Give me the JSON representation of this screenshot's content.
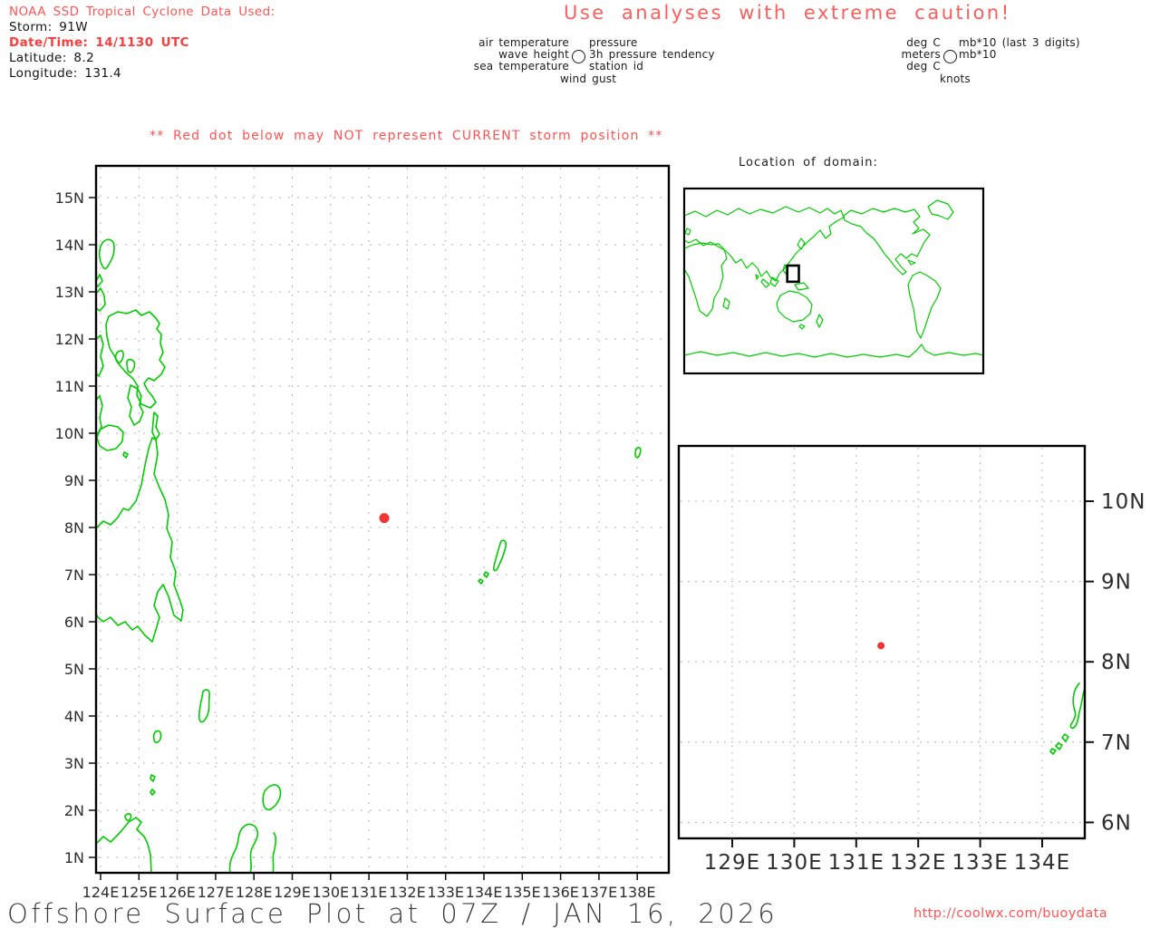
{
  "header": {
    "info_lines": [
      "NOAA SSD Tropical Cyclone Data Used:",
      "Storm: 91W",
      "Date/Time: 14/1130 UTC",
      "Latitude: 8.2",
      "Longitude: 131.4"
    ],
    "caution": "Use analyses with extreme caution!"
  },
  "station_legend": {
    "rows": [
      {
        "left": "air temperature",
        "right": "pressure"
      },
      {
        "left": "wave height",
        "right": "3h pressure tendency"
      },
      {
        "left": "sea temperature",
        "right": "station id"
      }
    ],
    "bottom": "wind gust",
    "units_rows": [
      {
        "left": "deg C",
        "right": "mb*10 (last 3 digits)"
      },
      {
        "left": "meters",
        "right": "mb*10"
      },
      {
        "left": "deg C",
        "right": ""
      }
    ],
    "units_bottom": "knots"
  },
  "warning": "** Red dot below may NOT represent CURRENT storm position **",
  "domain_inset": {
    "title": "Location of domain:"
  },
  "footer": {
    "title": "Offshore Surface Plot at 07Z / JAN 16, 2026",
    "url": "http://coolwx.com/buoydata"
  },
  "colors": {
    "red_text": "#ff5454",
    "red_bold": "#ff3b3b",
    "coastline": "#00cc00",
    "storm_dot": "#f03535",
    "grid": "#b4b4b4",
    "axis_text": "#2e2e2e",
    "border": "#000000"
  },
  "chart_data": {
    "type": "scatter",
    "title": "Offshore Surface Plot at 07Z / JAN 16, 2026",
    "maps": [
      {
        "name": "main-map",
        "xlim": [
          124,
          138
        ],
        "ylim": [
          1,
          15
        ],
        "x_ticks": [
          "124E",
          "125E",
          "126E",
          "127E",
          "128E",
          "129E",
          "130E",
          "131E",
          "132E",
          "133E",
          "134E",
          "135E",
          "136E",
          "137E",
          "138E"
        ],
        "y_ticks": [
          "15N",
          "14N",
          "13N",
          "12N",
          "11N",
          "10N",
          "9N",
          "8N",
          "7N",
          "6N",
          "5N",
          "4N",
          "3N",
          "2N",
          "1N"
        ],
        "grid": true,
        "points": [
          {
            "name": "storm-91W",
            "lon": 131.4,
            "lat": 8.2
          }
        ]
      },
      {
        "name": "zoom-inset",
        "xlim": [
          129,
          134
        ],
        "ylim": [
          6,
          10
        ],
        "x_ticks": [
          "129E",
          "130E",
          "131E",
          "132E",
          "133E",
          "134E"
        ],
        "y_ticks": [
          "10N",
          "9N",
          "8N",
          "7N",
          "6N"
        ],
        "grid": true,
        "points": [
          {
            "name": "storm-91W",
            "lon": 131.4,
            "lat": 8.2
          }
        ]
      },
      {
        "name": "world-domain-inset",
        "domain_box_lon": [
          124,
          138
        ],
        "domain_box_lat": [
          1,
          15
        ]
      }
    ]
  }
}
